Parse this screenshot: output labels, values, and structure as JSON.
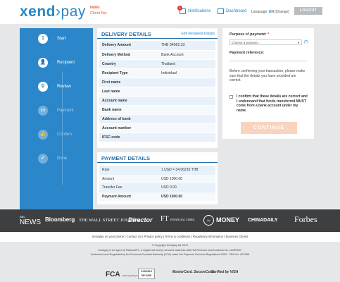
{
  "header": {
    "logo_text": "xend",
    "logo_text2": "pay",
    "hello": "Hello",
    "client_no_label": "Client No:",
    "notifications_badge": "1",
    "notifications_label": "Notifications",
    "dashboard_label": "Dashboard",
    "language_label": "Language:",
    "language_current": "EN",
    "language_other": "[Change]",
    "logout_label": "LOGOUT"
  },
  "steps": [
    {
      "number": "1",
      "label": "Start"
    },
    {
      "number": "",
      "label": "Recipient"
    },
    {
      "number": "",
      "label": "Review"
    },
    {
      "number": "",
      "label": "Payment"
    },
    {
      "number": "",
      "label": "Confirm"
    },
    {
      "number": "",
      "label": "Done"
    }
  ],
  "delivery": {
    "title": "DELIVERY DETAILS",
    "edit_link": "Edit Recipient Details",
    "rows": [
      {
        "k": "Delivery Amount",
        "v": "THB 34062.33"
      },
      {
        "k": "Delivery Method",
        "v": "Bank Account"
      },
      {
        "k": "Country",
        "v": "Thailand"
      },
      {
        "k": "Recipient Type",
        "v": "Individual"
      },
      {
        "k": "First name",
        "v": ""
      },
      {
        "k": "Last name",
        "v": ""
      },
      {
        "k": "Account name",
        "v": ""
      },
      {
        "k": "Bank name",
        "v": ""
      },
      {
        "k": "Address of bank",
        "v": ""
      },
      {
        "k": "Account number",
        "v": ""
      },
      {
        "k": "IFSC code",
        "v": ""
      }
    ]
  },
  "payment": {
    "title": "PAYMENT DETAILS",
    "rows": [
      {
        "k": "Rate",
        "v": "1 USD = 34.06233 THB"
      },
      {
        "k": "Amount",
        "v": "USD 1000.00"
      },
      {
        "k": "Transfer Fee",
        "v": "USD 0.00"
      },
      {
        "k": "Payment Amount",
        "v": "USD 1000.00"
      }
    ]
  },
  "right_panel": {
    "purpose_label": "Purpose of payment:",
    "purpose_required": "*",
    "purpose_placeholder": "Choose a purpose...",
    "help": "(?)",
    "reference_label": "Payment reference:",
    "note": "Before confirming your transaction, please make sure that the details you have provided are correct.",
    "confirm_text": "I confirm that these details are correct and I understand that funds transferred MUST come from a bank account under my name.",
    "continue_label": "CONTINUE"
  },
  "press": {
    "bbc": "BBC",
    "bbc_sub": "NEWS",
    "bloomberg": "Bloomberg",
    "wsj": "THE WALL STREET JOURNAL",
    "director": "Director",
    "ft": "FT",
    "ft_sub": "FINANCIAL TIMES",
    "itv": "itv",
    "money": "MONEY",
    "chinadaily": "CHINADAILY",
    "forbes": "Forbes"
  },
  "footer": {
    "links": "Xendpay on your phone  |  Contact Us  |  Privacy policy  |  Terms & conditions  |  Regulatory information  |  Business Clients",
    "copyright": "© Copyright Xendpay ltd. 2017",
    "line1": "Xendpay is an agent of RationalFX, a registered money services business with HM Revenue and Customs No. 12269957.",
    "line2": "Authorised and Regulated by the Financial Conduct Authority (FCA) under the Payment Services Regulations 2009 - FRN No. 507958",
    "badge_fca": "FCA",
    "badge_fca_sub": "Authorised Payment Institution",
    "badge_comodo": "COMODO SECURE",
    "badge_mc": "MasterCard. SecureCode.",
    "badge_visa": "Verified by VISA"
  }
}
